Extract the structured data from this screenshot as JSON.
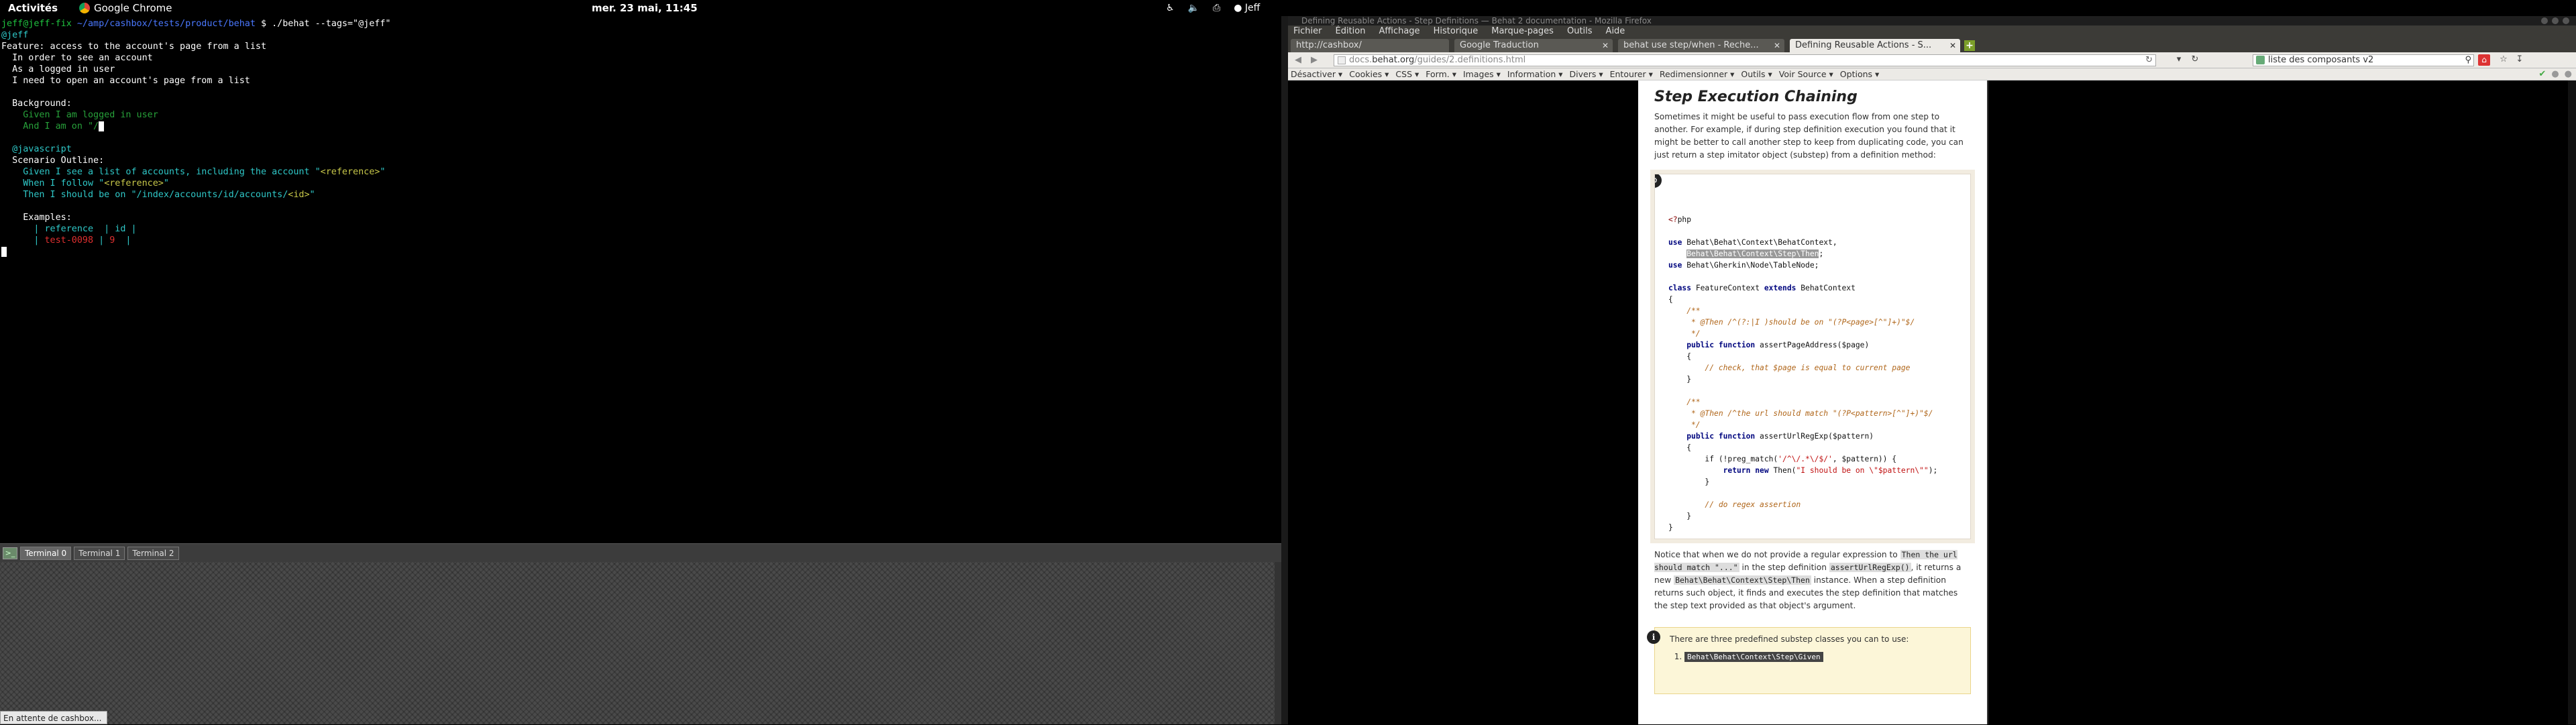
{
  "topbar": {
    "activities": "Activités",
    "app_name": "Google Chrome",
    "clock": "mer. 23 mai, 11:45",
    "user": "Jeff",
    "tray_icons": [
      "accessibility-icon",
      "volume-icon",
      "network-icon",
      "user-icon"
    ]
  },
  "terminal": {
    "lines": [
      [
        {
          "t": "jeff@jeff-fix",
          "c": "c-g"
        },
        {
          "t": " ~/amp/cashbox/tests/product/behat ",
          "c": "c-b"
        },
        {
          "t": "$ ./behat --tags=\"@jeff\"",
          "c": "c-w"
        }
      ],
      [
        {
          "t": "@jeff",
          "c": "c-c"
        }
      ],
      [
        {
          "t": "Feature: access to the account's page from a list",
          "c": "c-w"
        }
      ],
      [
        {
          "t": "  In order to see an account",
          "c": "c-w"
        }
      ],
      [
        {
          "t": "  As a logged in user",
          "c": "c-w"
        }
      ],
      [
        {
          "t": "  I need to open an account's page from a list",
          "c": "c-w"
        }
      ],
      [
        {
          "t": "",
          "c": "c-w"
        }
      ],
      [
        {
          "t": "  Background:",
          "c": "c-w"
        }
      ],
      [
        {
          "t": "    Given I am logged in user",
          "c": "c-dg"
        }
      ],
      [
        {
          "t": "    And I am on \"/",
          "c": "c-dg"
        },
        {
          "t": "",
          "c": "cursor"
        }
      ],
      [
        {
          "t": "",
          "c": "c-w"
        }
      ],
      [
        {
          "t": "  @javascript",
          "c": "c-c"
        }
      ],
      [
        {
          "t": "  Scenario Outline:",
          "c": "c-w"
        }
      ],
      [
        {
          "t": "    Given I see a list of accounts, including the account \"",
          "c": "c-c"
        },
        {
          "t": "<reference>",
          "c": "c-y"
        },
        {
          "t": "\"",
          "c": "c-c"
        }
      ],
      [
        {
          "t": "    When I follow \"",
          "c": "c-c"
        },
        {
          "t": "<reference>",
          "c": "c-y"
        },
        {
          "t": "\"",
          "c": "c-c"
        }
      ],
      [
        {
          "t": "    Then I should be on \"/index/accounts/id/accounts/",
          "c": "c-c"
        },
        {
          "t": "<id>",
          "c": "c-y"
        },
        {
          "t": "\"",
          "c": "c-c"
        }
      ],
      [
        {
          "t": "",
          "c": "c-w"
        }
      ],
      [
        {
          "t": "    Examples:",
          "c": "c-w"
        }
      ],
      [
        {
          "t": "      | reference  | id |",
          "c": "c-c"
        }
      ],
      [
        {
          "t": "      | ",
          "c": "c-c"
        },
        {
          "t": "test-0098",
          "c": "c-r"
        },
        {
          "t": " | ",
          "c": "c-c"
        },
        {
          "t": "9",
          "c": "c-r"
        },
        {
          "t": "  |",
          "c": "c-c"
        }
      ],
      [
        {
          "t": "",
          "c": "cursor"
        }
      ]
    ],
    "tabs": [
      "Terminal 0",
      "Terminal 1",
      "Terminal 2"
    ],
    "active_tab": 0,
    "status": "En attente de cashbox..."
  },
  "firefox": {
    "window_title": "Defining Reusable Actions - Step Definitions — Behat 2 documentation - Mozilla Firefox",
    "menu": [
      "Fichier",
      "Édition",
      "Affichage",
      "Historique",
      "Marque-pages",
      "Outils",
      "Aide"
    ],
    "tabs": [
      {
        "label": "http://cashbox/"
      },
      {
        "label": "Google Traduction"
      },
      {
        "label": "behat use step/when - Reche..."
      },
      {
        "label": "Defining Reusable Actions - S..."
      }
    ],
    "url_prefix": "docs.",
    "url_domain": "behat.org",
    "url_path": "/guides/2.definitions.html",
    "search_value": "liste des composants v2",
    "devbar": [
      "Désactiver ▾",
      "Cookies ▾",
      "CSS ▾",
      "Form. ▾",
      "Images ▾",
      "Information ▾",
      "Divers ▾",
      "Entourer ▾",
      "Redimensionner ▾",
      "Outils ▾",
      "Voir Source ▾",
      "Options ▾"
    ],
    "page": {
      "heading": "Step Execution Chaining",
      "intro": "Sometimes it might be useful to pass execution flow from one step to another. For example, if during step definition execution you found that it might be better to call another step to keep from duplicating code, you can just return a step imitator object (substep) from a definition method:",
      "code": [
        [
          {
            "t": "<?",
            "c": "ph"
          },
          {
            "t": "php",
            "c": ""
          }
        ],
        [
          {
            "t": "",
            "c": ""
          }
        ],
        [
          {
            "t": "use",
            "c": "k"
          },
          {
            "t": " Behat\\Behat\\Context\\BehatContext,",
            "c": ""
          }
        ],
        [
          {
            "t": "    ",
            "c": ""
          },
          {
            "t": "Behat\\Behat\\Context\\Step\\Then",
            "c": "hl"
          },
          {
            "t": ";",
            "c": ""
          }
        ],
        [
          {
            "t": "use",
            "c": "k"
          },
          {
            "t": " Behat\\Gherkin\\Node\\TableNode;",
            "c": ""
          }
        ],
        [
          {
            "t": "",
            "c": ""
          }
        ],
        [
          {
            "t": "class",
            "c": "k"
          },
          {
            "t": " FeatureContext ",
            "c": ""
          },
          {
            "t": "extends",
            "c": "k"
          },
          {
            "t": " BehatContext",
            "c": ""
          }
        ],
        [
          {
            "t": "{",
            "c": ""
          }
        ],
        [
          {
            "t": "    /**",
            "c": "cm"
          }
        ],
        [
          {
            "t": "     * @Then /^(?:|I )should be on \"(?P<page>[^\"]+)\"$/",
            "c": "cm"
          }
        ],
        [
          {
            "t": "     */",
            "c": "cm"
          }
        ],
        [
          {
            "t": "    ",
            "c": ""
          },
          {
            "t": "public function",
            "c": "k"
          },
          {
            "t": " assertPageAddress($page)",
            "c": ""
          }
        ],
        [
          {
            "t": "    {",
            "c": ""
          }
        ],
        [
          {
            "t": "        // check, that $page is equal to current page",
            "c": "cm"
          }
        ],
        [
          {
            "t": "    }",
            "c": ""
          }
        ],
        [
          {
            "t": "",
            "c": ""
          }
        ],
        [
          {
            "t": "    /**",
            "c": "cm"
          }
        ],
        [
          {
            "t": "     * @Then /^the url should match \"(?P<pattern>[^\"]+)\"$/",
            "c": "cm"
          }
        ],
        [
          {
            "t": "     */",
            "c": "cm"
          }
        ],
        [
          {
            "t": "    ",
            "c": ""
          },
          {
            "t": "public function",
            "c": "k"
          },
          {
            "t": " assertUrlRegExp($pattern)",
            "c": ""
          }
        ],
        [
          {
            "t": "    {",
            "c": ""
          }
        ],
        [
          {
            "t": "        if (!preg_match(",
            "c": ""
          },
          {
            "t": "'/^\\/.*\\/$/'",
            "c": "st"
          },
          {
            "t": ", $pattern)) {",
            "c": ""
          }
        ],
        [
          {
            "t": "            ",
            "c": ""
          },
          {
            "t": "return new",
            "c": "k"
          },
          {
            "t": " Then(",
            "c": ""
          },
          {
            "t": "\"I should be on \\\"$pattern\\\"\"",
            "c": "st"
          },
          {
            "t": ");",
            "c": ""
          }
        ],
        [
          {
            "t": "        }",
            "c": ""
          }
        ],
        [
          {
            "t": "",
            "c": ""
          }
        ],
        [
          {
            "t": "        // do regex assertion",
            "c": "cm"
          }
        ],
        [
          {
            "t": "    }",
            "c": ""
          }
        ],
        [
          {
            "t": "}",
            "c": ""
          }
        ]
      ],
      "notice_parts": [
        {
          "t": "Notice that when we do not provide a regular expression to ",
          "code": false
        },
        {
          "t": "Then the url should match \"...\"",
          "code": true
        },
        {
          "t": " in the step definition ",
          "code": false
        },
        {
          "t": "assertUrlRegExp()",
          "code": true
        },
        {
          "t": ", it returns a new ",
          "code": false
        },
        {
          "t": "Behat\\Behat\\Context\\Step\\Then",
          "code": true
        },
        {
          "t": " instance. When a step definition returns such object, it finds and executes the step definition that matches the step text provided as that object's argument.",
          "code": false
        }
      ],
      "note_title": "There are three predefined substep classes you can to use:",
      "note_items": [
        "Behat\\Behat\\Context\\Step\\Given"
      ]
    }
  }
}
